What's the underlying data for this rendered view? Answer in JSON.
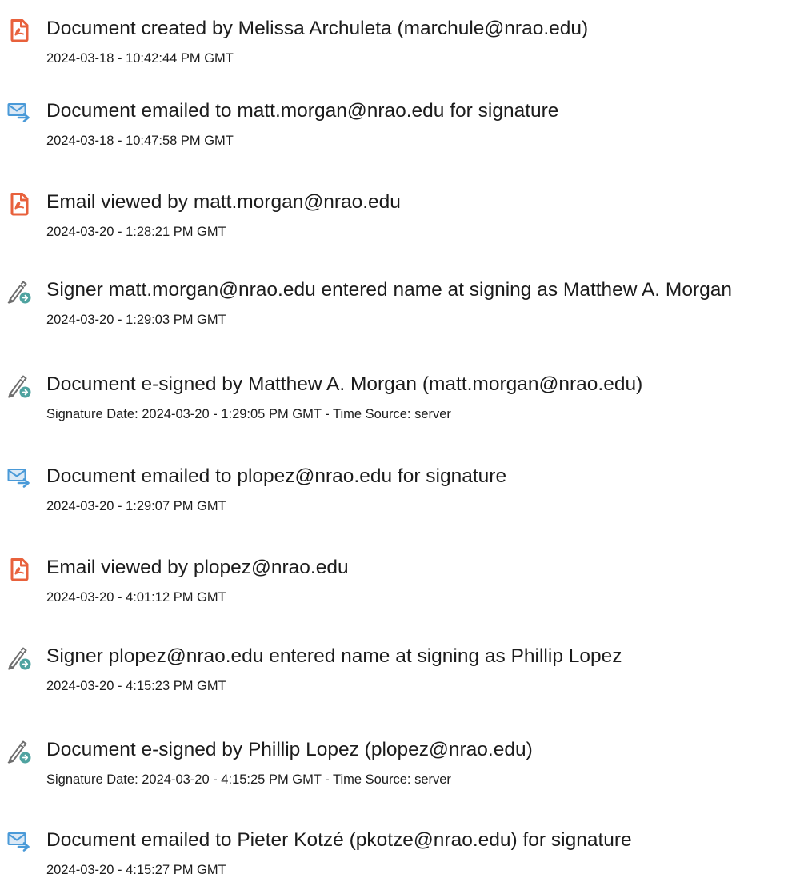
{
  "colors": {
    "created_icon": "#e8613c",
    "emailed_icon": "#4a9ad8",
    "signed_icon": "#4fa3a0"
  },
  "events": [
    {
      "icon": "document-created-icon",
      "title": "Document created by Melissa Archuleta (marchule@nrao.edu)",
      "meta": "2024-03-18 - 10:42:44 PM GMT"
    },
    {
      "icon": "email-sent-icon",
      "title": "Document emailed to matt.morgan@nrao.edu for signature",
      "meta": "2024-03-18 - 10:47:58 PM GMT"
    },
    {
      "icon": "document-viewed-icon",
      "title": "Email viewed by matt.morgan@nrao.edu",
      "meta": "2024-03-20 - 1:28:21 PM GMT"
    },
    {
      "icon": "e-sign-pen-icon",
      "title": "Signer matt.morgan@nrao.edu entered name at signing as Matthew A. Morgan",
      "meta": "2024-03-20 - 1:29:03 PM GMT"
    },
    {
      "icon": "e-sign-pen-icon",
      "title": "Document e-signed by Matthew A. Morgan (matt.morgan@nrao.edu)",
      "meta": "Signature Date: 2024-03-20 - 1:29:05 PM GMT - Time Source: server"
    },
    {
      "icon": "email-sent-icon",
      "title": "Document emailed to plopez@nrao.edu for signature",
      "meta": "2024-03-20 - 1:29:07 PM GMT"
    },
    {
      "icon": "document-viewed-icon",
      "title": "Email viewed by plopez@nrao.edu",
      "meta": "2024-03-20 - 4:01:12 PM GMT"
    },
    {
      "icon": "e-sign-pen-icon",
      "title": "Signer plopez@nrao.edu entered name at signing as Phillip Lopez",
      "meta": "2024-03-20 - 4:15:23 PM GMT"
    },
    {
      "icon": "e-sign-pen-icon",
      "title": "Document e-signed by Phillip Lopez (plopez@nrao.edu)",
      "meta": "Signature Date: 2024-03-20 - 4:15:25 PM GMT - Time Source: server"
    },
    {
      "icon": "email-sent-icon",
      "title": "Document emailed to Pieter Kotzé (pkotze@nrao.edu) for signature",
      "meta": "2024-03-20 - 4:15:27 PM GMT"
    }
  ]
}
